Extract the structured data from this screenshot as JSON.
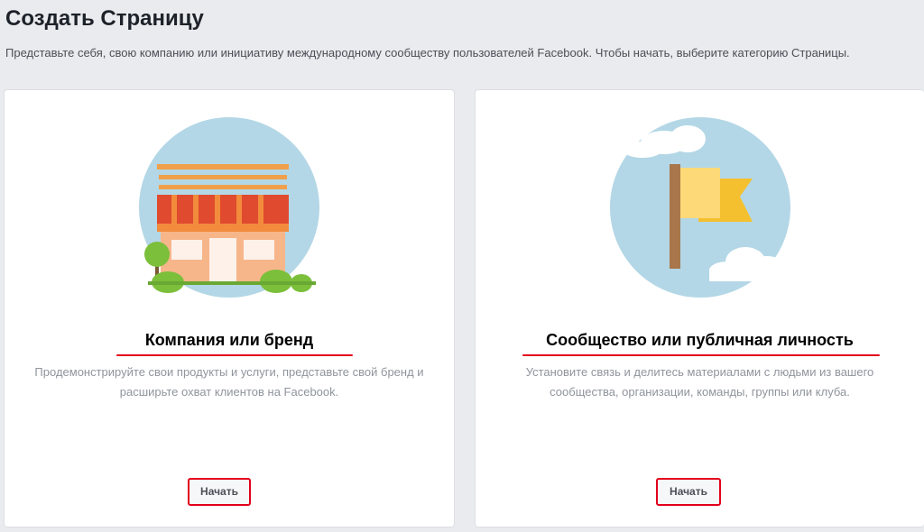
{
  "page": {
    "title": "Создать Страницу",
    "description": "Представьте себя, свою компанию или инициативу международному сообществу пользователей Facebook. Чтобы начать, выберите категорию Страницы."
  },
  "cards": [
    {
      "id": "business",
      "illustration": "storefront-icon",
      "title": "Компания или бренд",
      "description": "Продемонстрируйте свои продукты и услуги, представьте свой бренд и расширьте охват клиентов на Facebook.",
      "button_label": "Начать"
    },
    {
      "id": "community",
      "illustration": "flag-icon",
      "title": "Сообщество или публичная личность",
      "description": "Установите связь и делитесь материалами с людьми из вашего сообщества, организации, команды, группы или клуба.",
      "button_label": "Начать"
    }
  ],
  "colors": {
    "background": "#e9ebee",
    "card": "#ffffff",
    "annotation_red": "#e3001b",
    "muted_text": "#90949c",
    "illustration_circle": "#b3d7e6"
  }
}
